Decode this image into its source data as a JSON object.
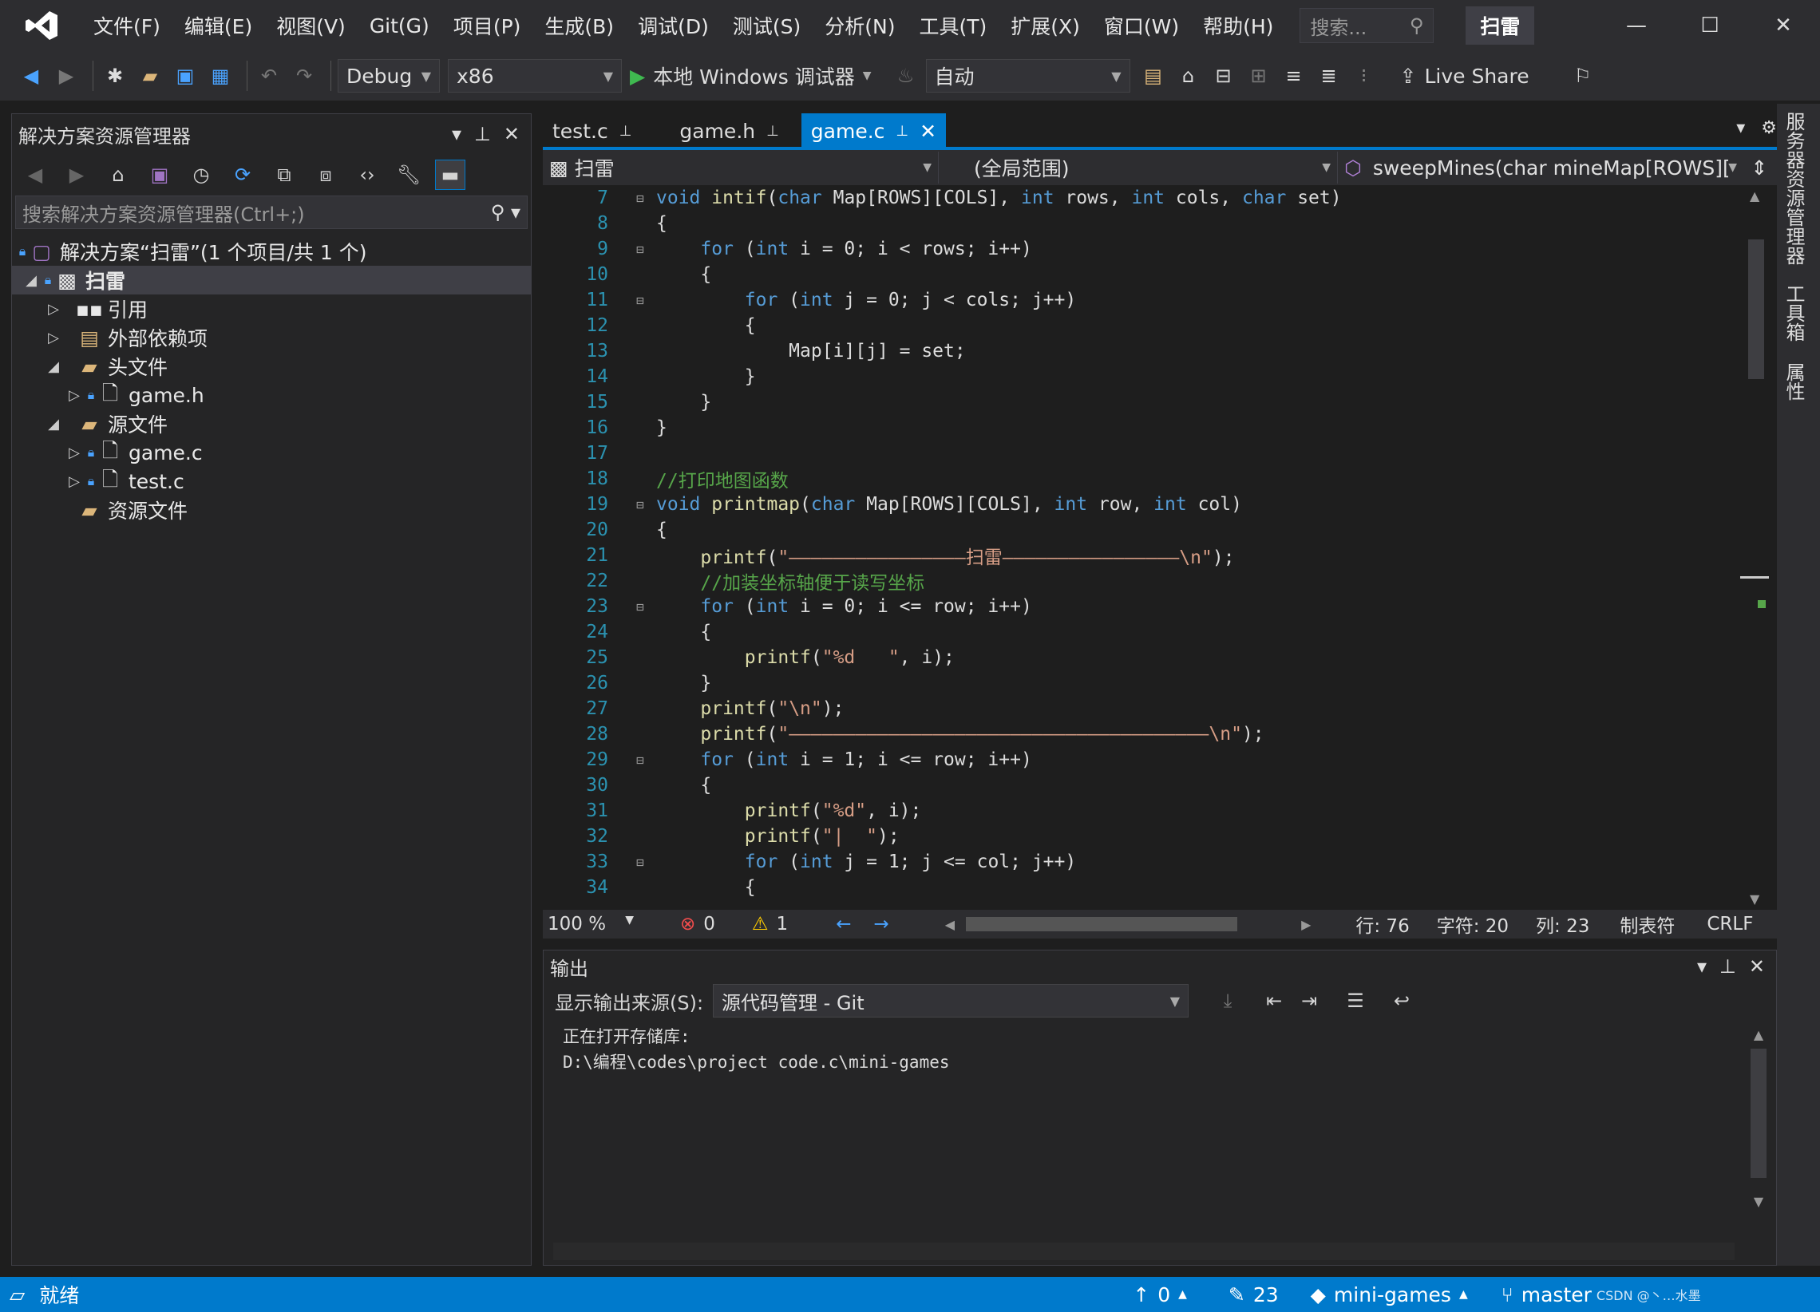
{
  "menu": {
    "items": [
      "文件(F)",
      "编辑(E)",
      "视图(V)",
      "Git(G)",
      "项目(P)",
      "生成(B)",
      "调试(D)",
      "测试(S)",
      "分析(N)",
      "工具(T)",
      "扩展(X)",
      "窗口(W)",
      "帮助(H)"
    ],
    "search_placeholder": "搜索...",
    "solution_title": "扫雷"
  },
  "toolbar": {
    "config": "Debug",
    "platform": "x86",
    "run_label": "本地 Windows 调试器",
    "auto": "自动",
    "live_share": "Live Share"
  },
  "solution": {
    "title": "解决方案资源管理器",
    "search_placeholder": "搜索解决方案资源管理器(Ctrl+;)",
    "root": "解决方案“扫雷”(1 个项目/共 1 个)",
    "project": "扫雷",
    "items": {
      "refs": "引用",
      "external": "外部依赖项",
      "headers": "头文件",
      "game_h": "game.h",
      "sources": "源文件",
      "game_c": "game.c",
      "test_c": "test.c",
      "resources": "资源文件"
    }
  },
  "tabs": [
    {
      "label": "test.c"
    },
    {
      "label": "game.h"
    },
    {
      "label": "game.c"
    }
  ],
  "navbar": {
    "project": "扫雷",
    "scope": "(全局范围)",
    "member": "sweepMines(char mineMap[ROWS][C"
  },
  "code": [
    {
      "n": "7",
      "t": "void intif(char Map[ROWS][COLS], int rows, int cols, char set)"
    },
    {
      "n": "8",
      "t": "{"
    },
    {
      "n": "9",
      "t": "    for (int i = 0; i < rows; i++)"
    },
    {
      "n": "10",
      "t": "    {"
    },
    {
      "n": "11",
      "t": "        for (int j = 0; j < cols; j++)"
    },
    {
      "n": "12",
      "t": "        {"
    },
    {
      "n": "13",
      "t": "            Map[i][j] = set;"
    },
    {
      "n": "14",
      "t": "        }"
    },
    {
      "n": "15",
      "t": "    }"
    },
    {
      "n": "16",
      "t": "}"
    },
    {
      "n": "17",
      "t": ""
    },
    {
      "n": "18",
      "t": "//打印地图函数"
    },
    {
      "n": "19",
      "t": "void printmap(char Map[ROWS][COLS], int row, int col)"
    },
    {
      "n": "20",
      "t": "{"
    },
    {
      "n": "21",
      "t": "    printf(\"————————————————扫雷————————————————\\n\");"
    },
    {
      "n": "22",
      "t": "    //加装坐标轴便于读写坐标"
    },
    {
      "n": "23",
      "t": "    for (int i = 0; i <= row; i++)"
    },
    {
      "n": "24",
      "t": "    {"
    },
    {
      "n": "25",
      "t": "        printf(\"%d   \", i);"
    },
    {
      "n": "26",
      "t": "    }"
    },
    {
      "n": "27",
      "t": "    printf(\"\\n\");"
    },
    {
      "n": "28",
      "t": "    printf(\"——————————————————————————————————————\\n\");"
    },
    {
      "n": "29",
      "t": "    for (int i = 1; i <= row; i++)"
    },
    {
      "n": "30",
      "t": "    {"
    },
    {
      "n": "31",
      "t": "        printf(\"%d\", i);"
    },
    {
      "n": "32",
      "t": "        printf(\"|  \");"
    },
    {
      "n": "33",
      "t": "        for (int j = 1; j <= col; j++)"
    },
    {
      "n": "34",
      "t": "        {"
    }
  ],
  "editor_status": {
    "zoom": "100 %",
    "errors": "0",
    "warnings": "1",
    "line": "行: 76",
    "char": "字符: 20",
    "col": "列: 23",
    "tabs": "制表符",
    "eol": "CRLF"
  },
  "output": {
    "title": "输出",
    "source_label": "显示输出来源(S):",
    "source_value": "源代码管理 - Git",
    "line1": "正在打开存储库:",
    "line2": "D:\\编程\\codes\\project code.c\\mini-games"
  },
  "side_tabs": [
    "服务器资源管理器",
    "工具箱",
    "属性"
  ],
  "statusbar": {
    "ready": "就绪",
    "up": "0",
    "edits": "23",
    "repo": "mini-games",
    "branch": "master",
    "watermark": "CSDN @丶…水墨"
  }
}
